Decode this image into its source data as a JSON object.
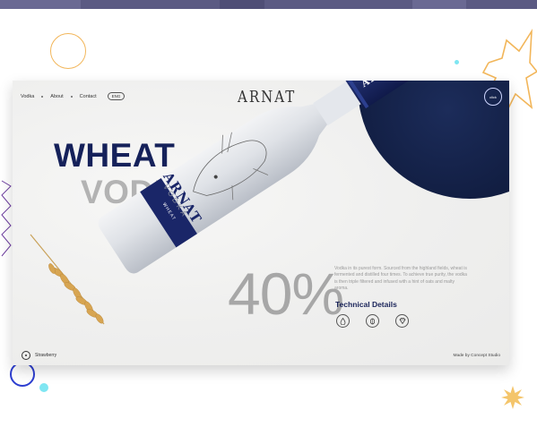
{
  "nav": {
    "items": [
      "Vodka",
      "About",
      "Contact"
    ],
    "lang": "ENG"
  },
  "logo": "ARNAT",
  "click_label": "click",
  "hero": {
    "title_line1": "WHEAT",
    "title_line2": "VODKA",
    "percent": "40%"
  },
  "bottle": {
    "cap_brand": "ARNAT",
    "label_brand": "ARNAT",
    "label_type": "VODKA",
    "band_text": "WHEAT"
  },
  "description": "Vodka in its purest form. Sourced from the highland fields, wheat is fermented and distilled four times. To achieve true purity, the vodka is then triple filtered and infused with a hint of oats and malty aroma.",
  "tech_details": {
    "title": "Technical Details",
    "icons": [
      "drop-icon",
      "grain-icon",
      "diamond-icon"
    ]
  },
  "flavor": {
    "label": "Strawberry"
  },
  "credit": "Made by Concept Studio",
  "colors": {
    "navy": "#15215a",
    "gray_text": "#b3b3b3",
    "accent_orange": "#f2b65a",
    "accent_blue": "#5f9cff",
    "accent_purple": "#6e3fa0"
  }
}
